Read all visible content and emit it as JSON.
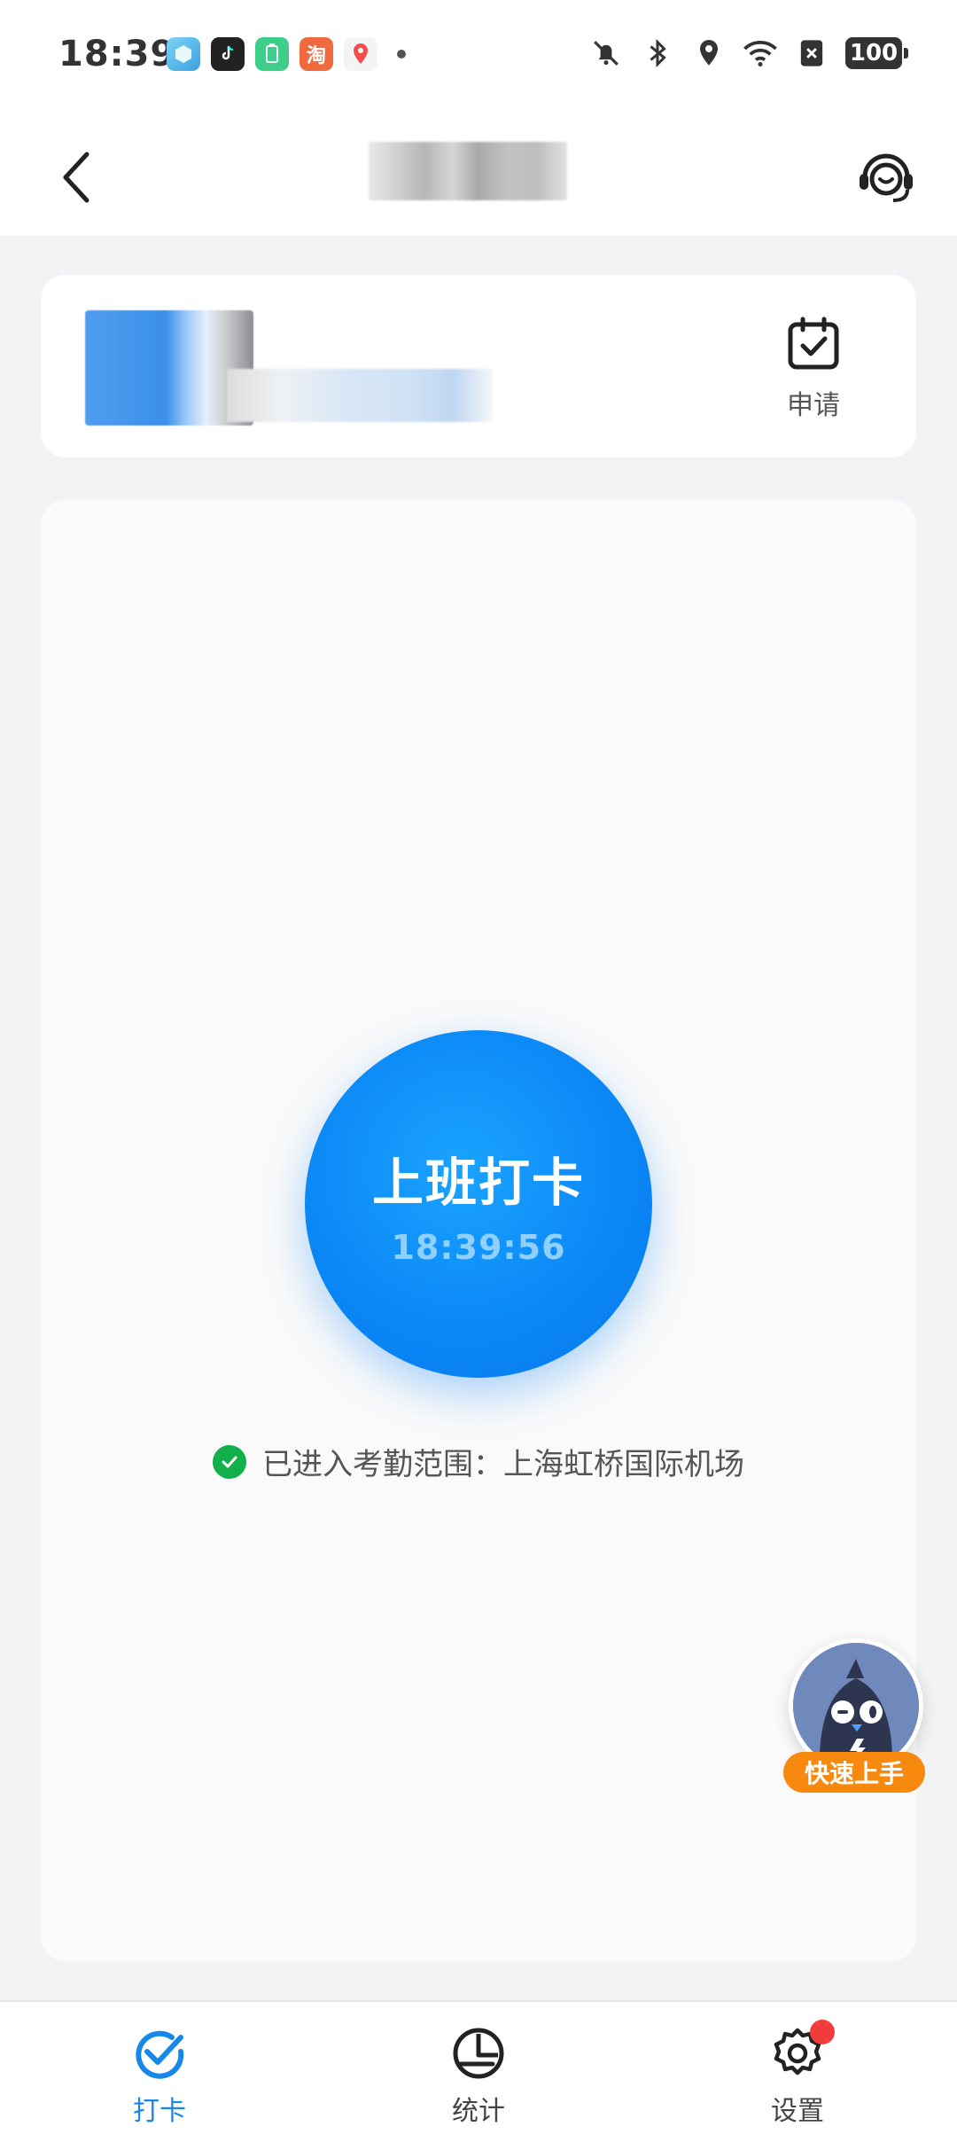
{
  "status_bar": {
    "time": "18:39",
    "battery": "100",
    "app_icons": [
      "cube-app-icon",
      "tiktok-icon",
      "battery-app-icon",
      "taobao-icon",
      "maps-icon"
    ],
    "taobao_glyph": "淘"
  },
  "nav": {
    "back_icon": "chevron-left-icon",
    "support_icon": "headset-icon"
  },
  "info_card": {
    "apply_label": "申请"
  },
  "checkin": {
    "label": "上班打卡",
    "time": "18:39:56",
    "range_text": "已进入考勤范围：上海虹桥国际机场"
  },
  "helper": {
    "badge": "快速上手"
  },
  "tabs": [
    {
      "label": "打卡",
      "icon": "check-icon",
      "active": true
    },
    {
      "label": "统计",
      "icon": "pie-chart-icon",
      "active": false
    },
    {
      "label": "设置",
      "icon": "gear-icon",
      "active": false,
      "has_notification": true
    }
  ],
  "colors": {
    "accent": "#1688e9",
    "checkin_blue": "#0a86f5",
    "success_green": "#12b04a",
    "badge_orange": "#f7890f",
    "notify_red": "#f23b3b"
  }
}
